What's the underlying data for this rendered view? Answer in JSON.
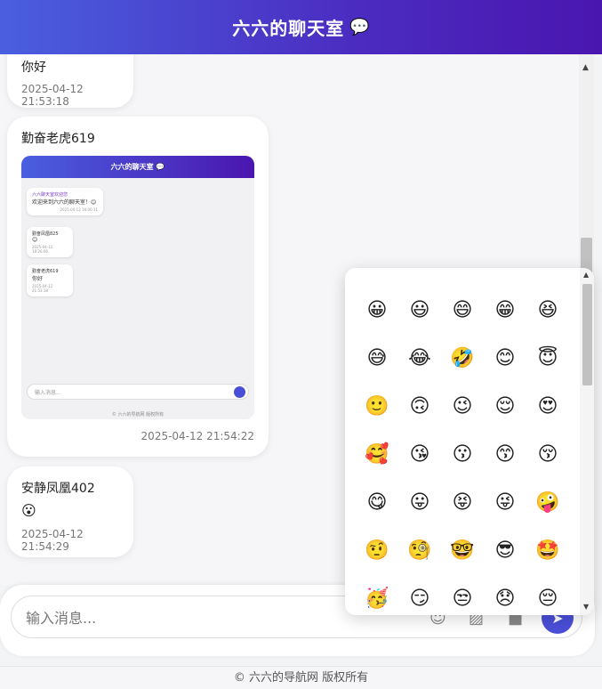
{
  "header": {
    "title": "六六的聊天室",
    "icon": "💬"
  },
  "messages": [
    {
      "text": "你好",
      "time": "2025-04-12 21:53:18"
    },
    {
      "name": "勤奋老虎619",
      "time": "2025-04-12 21:54:22",
      "screenshot": {
        "title": "六六的聊天室 💬",
        "msgs": [
          {
            "name": "六六聊天室欢迎您",
            "text": "欢迎来到六六的聊天室！😊",
            "time": "2025-04-12 16:00:11"
          },
          {
            "name": "勤奋凤凰825",
            "text": "😊",
            "time": "2025-04-12 18:26:06"
          },
          {
            "name": "勤奋老虎619",
            "text": "你好",
            "time": "2025-04-12 21:53:18"
          }
        ],
        "placeholder": "输入消息...",
        "footer": "© 六六的导航网 版权所有"
      }
    },
    {
      "name": "安静凤凰402",
      "text": "😮",
      "time": "2025-04-12 21:54:29"
    }
  ],
  "input": {
    "placeholder": "输入消息..."
  },
  "toolbar": {
    "emoji_icon": "☺",
    "image_icon": "▨",
    "video_icon": "■",
    "send_icon": "➤"
  },
  "footer": {
    "text": "© 六六的导航网 版权所有"
  },
  "emoji_panel": {
    "emojis": [
      "😀",
      "😃",
      "😄",
      "😁",
      "😆",
      "😅",
      "😂",
      "🤣",
      "😊",
      "😇",
      "🙂",
      "🙃",
      "😉",
      "😌",
      "😍",
      "🥰",
      "😘",
      "😗",
      "😙",
      "😚",
      "😋",
      "😛",
      "😝",
      "😜",
      "🤪",
      "🤨",
      "🧐",
      "🤓",
      "😎",
      "🤩",
      "🥳",
      "😏",
      "😒",
      "😞",
      "😔"
    ]
  }
}
